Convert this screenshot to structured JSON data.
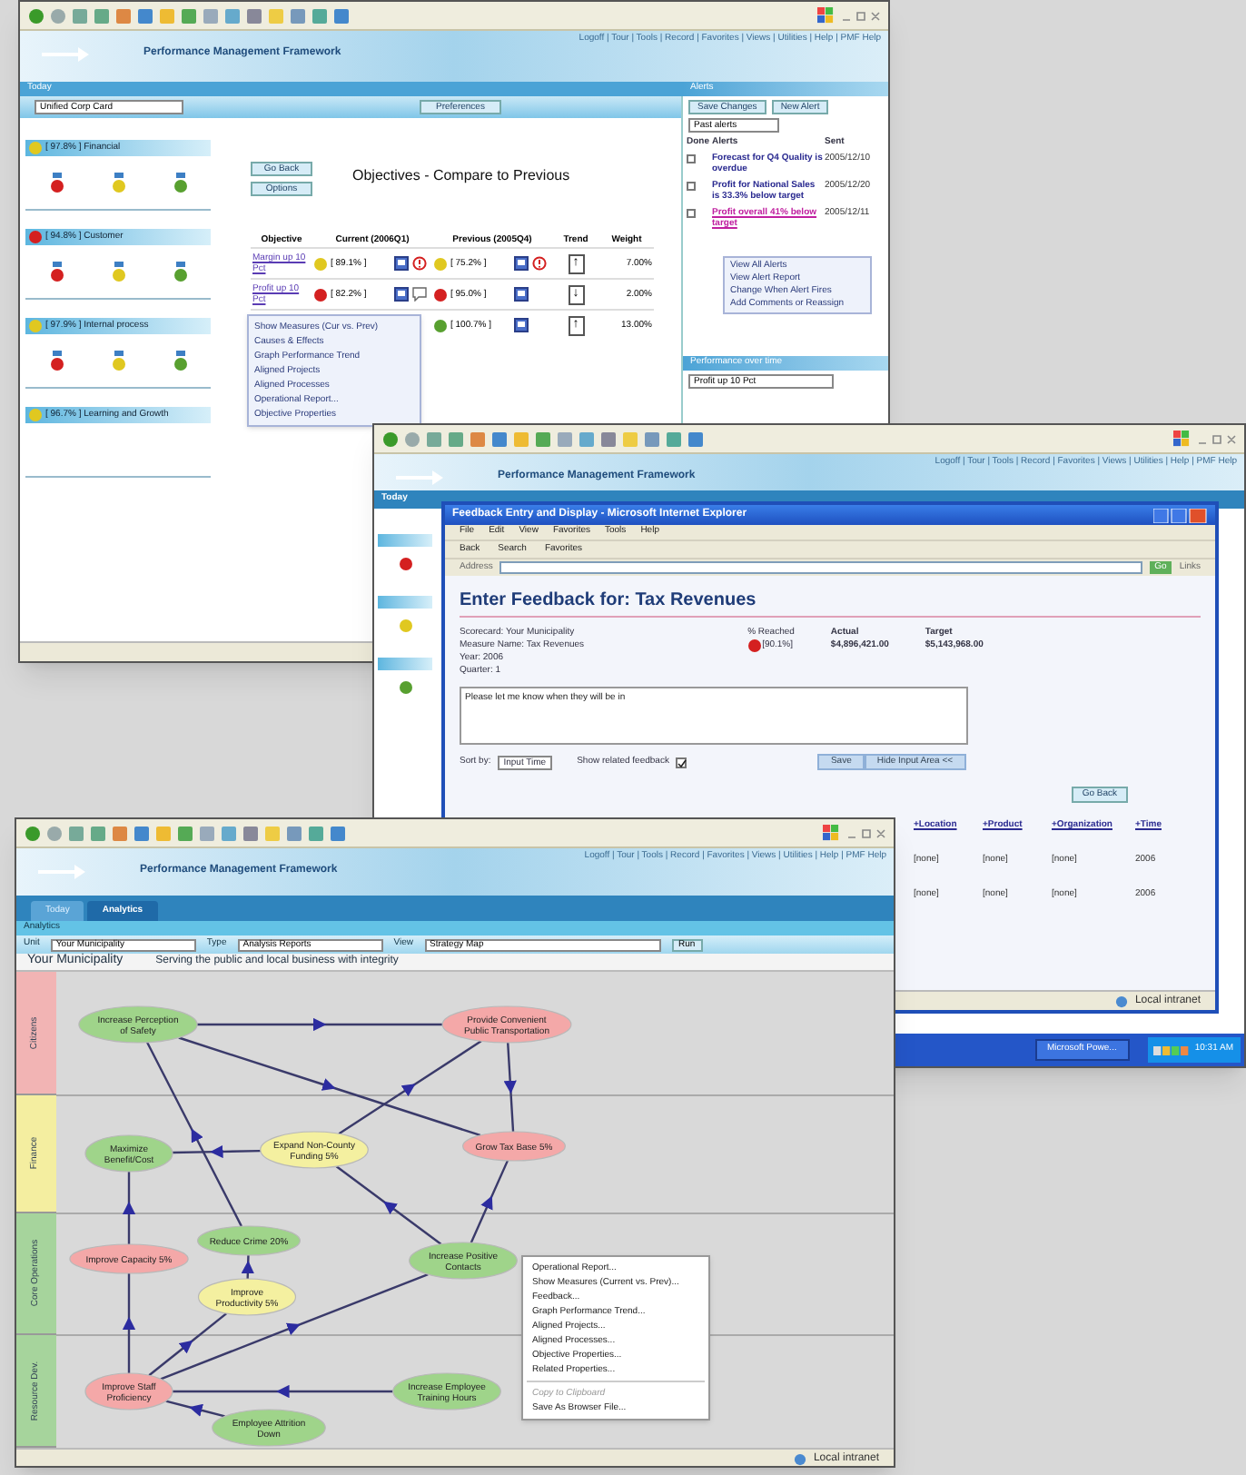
{
  "scorecard_window": {
    "nav_links": "Logoff | Tour | Tools | Record | Favorites | Views | Utilities | Help | PMF Help",
    "app_title": "Performance Management Framework",
    "tab_bar": "Today",
    "scorecard_select": "Unified Corp Card",
    "preferences_button": "Preferences",
    "perspectives": [
      {
        "score": "[ 97.8% ]",
        "name": "Financial",
        "color": "#e0c820",
        "objectives": [
          {
            "color": "#d42020"
          },
          {
            "color": "#e0c820"
          },
          {
            "color": "#58a030"
          }
        ]
      },
      {
        "score": "[ 94.8% ]",
        "name": "Customer",
        "color": "#d42020",
        "objectives": [
          {
            "color": "#d42020"
          },
          {
            "color": "#e0c820"
          },
          {
            "color": "#58a030"
          }
        ]
      },
      {
        "score": "[ 97.9% ]",
        "name": "Internal process",
        "color": "#e0c820",
        "objectives": [
          {
            "color": "#d42020"
          },
          {
            "color": "#e0c820"
          },
          {
            "color": "#58a030"
          }
        ]
      },
      {
        "score": "[ 96.7% ]",
        "name": "Learning and Growth",
        "color": "#e0c820"
      }
    ],
    "buttons": [
      "Go Back",
      "Options"
    ],
    "title": "Objectives - Compare to Previous",
    "columns": [
      "Objective",
      "Current (2006Q1)",
      "Previous (2005Q4)",
      "Trend",
      "Weight"
    ],
    "rows": [
      {
        "objective": "Margin up 10 Pct",
        "current": {
          "text": "[ 89.1% ]",
          "color": "#e0c820",
          "alert": true
        },
        "previous": {
          "text": "[ 75.2% ]",
          "color": "#e0c820",
          "alert": true
        },
        "trend": "↑",
        "weight": "7.00%"
      },
      {
        "objective": "Profit up 10 Pct",
        "current": {
          "text": "[ 82.2% ]",
          "color": "#d42020",
          "comment": true
        },
        "previous": {
          "text": "[ 95.0% ]",
          "color": "#d42020"
        },
        "trend": "↓",
        "weight": "2.00%"
      },
      {
        "previous": {
          "text": "[ 100.7% ]",
          "color": "#58a030"
        },
        "trend": "↑",
        "weight": "13.00%"
      }
    ],
    "context_menu": [
      "Show Measures (Cur vs. Prev)",
      "Causes & Effects",
      "Graph Performance Trend",
      "Aligned Projects",
      "Aligned Processes",
      "Operational Report...",
      "Objective Properties"
    ],
    "alerts_panel": {
      "title": "Alerts",
      "buttons": [
        "Save Changes",
        "New Alert"
      ],
      "filter": "Past alerts",
      "columns": [
        "Done",
        "Alerts",
        "Sent"
      ],
      "rows": [
        {
          "text": "Forecast for Q4 Quality is overdue",
          "date": "2005/12/10",
          "checked": false,
          "selected": false
        },
        {
          "text": "Profit for National Sales is 33.3% below target",
          "date": "2005/12/20",
          "checked": false,
          "selected": false
        },
        {
          "text": "Profit overall 41% below target",
          "date": "2005/12/11",
          "checked": false,
          "selected": true
        }
      ],
      "menu": [
        "View All Alerts",
        "View Alert Report",
        "Change When Alert Fires",
        "Add Comments or Reassign"
      ]
    },
    "trend_panel": {
      "title": "Performance over time",
      "select": "Profit up 10 Pct"
    }
  },
  "feedback_window": {
    "nav_links": "Logoff | Tour | Tools | Record | Favorites | Views | Utilities | Help | PMF Help",
    "app_title": "Performance Management Framework",
    "tab": "Today",
    "left_balls": [
      {
        "color": "#d42020"
      },
      {
        "color": "#e0c820"
      },
      {
        "color": "#58a030"
      }
    ],
    "popup": {
      "title": "Feedback Entry and Display - Microsoft Internet Explorer",
      "menu": [
        "File",
        "Edit",
        "View",
        "Favorites",
        "Tools",
        "Help"
      ],
      "toolbar": [
        "Back",
        "Search",
        "Favorites"
      ],
      "address_label": "Address",
      "go": "Go",
      "links": "Links",
      "heading": "Enter Feedback for: Tax Revenues",
      "info": [
        "Scorecard: Your Municipality",
        "Measure Name: Tax Revenues",
        "Year: 2006",
        "Quarter: 1"
      ],
      "reached_label": "% Reached",
      "reached": {
        "text": "[90.1%]",
        "color": "#d42020"
      },
      "actual_label": "Actual",
      "actual": "$4,896,421.00",
      "target_label": "Target",
      "target": "$5,143,968.00",
      "feedback": "Please let me know when they will be in",
      "sort_label": "Sort by:",
      "sort_value": "Input Time",
      "related_label": "Show related feedback",
      "related_checked": true,
      "buttons": [
        "Save",
        "Hide Input Area <<"
      ],
      "go_back": "Go Back",
      "columns": [
        "+Location",
        "+Product",
        "+Organization",
        "+Time"
      ],
      "rows": [
        [
          "[none]",
          "[none]",
          "[none]",
          "2006"
        ],
        [
          "[none]",
          "[none]",
          "[none]",
          "2006"
        ]
      ],
      "status": "Local intranet"
    },
    "taskbar": {
      "button": "Microsoft Powe...",
      "clock": "10:31 AM"
    }
  },
  "strategy_window": {
    "nav_links": "Logoff | Tour | Tools | Record | Favorites | Views | Utilities | Help | PMF Help",
    "app_title": "Performance Management Framework",
    "tabs": [
      {
        "label": "Today",
        "selected": false
      },
      {
        "label": "Analytics",
        "selected": true
      }
    ],
    "section": "Analytics",
    "filters": [
      {
        "label": "Unit",
        "value": "Your Municipality"
      },
      {
        "label": "Type",
        "value": "Analysis Reports"
      },
      {
        "label": "View",
        "value": "Strategy Map"
      }
    ],
    "run": "Run",
    "organization": "Your Municipality",
    "mission": "Serving the public and local business with integrity",
    "lanes": [
      {
        "label": "Citizens",
        "color": "#f2b4b4"
      },
      {
        "label": "Finance",
        "color": "#f4eea0"
      },
      {
        "label": "Core Operations",
        "color": "#a6d49c"
      },
      {
        "label": "Resource Dev.",
        "color": "#a6d49c"
      }
    ],
    "nodes": [
      {
        "lines": [
          "Increase Perception",
          "of Safety"
        ],
        "color": "#9fd48a"
      },
      {
        "lines": [
          "Provide Convenient",
          "Public Transportation"
        ],
        "color": "#f4a8a8"
      },
      {
        "lines": [
          "Maximize",
          "Benefit/Cost"
        ],
        "color": "#9fd48a"
      },
      {
        "lines": [
          "Expand Non-County",
          "Funding 5%"
        ],
        "color": "#f4f0a0"
      },
      {
        "lines": [
          "Grow Tax Base 5%"
        ],
        "color": "#f4a8a8"
      },
      {
        "lines": [
          "Reduce Crime 20%"
        ],
        "color": "#9fd48a"
      },
      {
        "lines": [
          "Improve Capacity 5%"
        ],
        "color": "#f4a8a8"
      },
      {
        "lines": [
          "Increase Positive",
          "Contacts"
        ],
        "color": "#9fd48a"
      },
      {
        "lines": [
          "Improve",
          "Productivity 5%"
        ],
        "color": "#f4f0a0"
      },
      {
        "lines": [
          "Improve Staff",
          "Proficiency"
        ],
        "color": "#f4a8a8"
      },
      {
        "lines": [
          "Increase Employee",
          "Training Hours"
        ],
        "color": "#9fd48a"
      },
      {
        "lines": [
          "Employee Attrition",
          "Down"
        ],
        "color": "#9fd48a"
      }
    ],
    "context_menu": [
      {
        "label": "Operational Report...",
        "disabled": false
      },
      {
        "label": "Show Measures (Current vs. Prev)...",
        "disabled": false
      },
      {
        "label": "Feedback...",
        "disabled": false
      },
      {
        "label": "Graph Performance Trend...",
        "disabled": false
      },
      {
        "label": "Aligned Projects...",
        "disabled": false
      },
      {
        "label": "Aligned Processes...",
        "disabled": false
      },
      {
        "label": "Objective Properties...",
        "disabled": false
      },
      {
        "label": "Related Properties...",
        "disabled": false
      },
      {
        "label": "Copy to Clipboard",
        "disabled": true
      },
      {
        "label": "Save As Browser File...",
        "disabled": false
      }
    ],
    "status": "Local intranet"
  }
}
